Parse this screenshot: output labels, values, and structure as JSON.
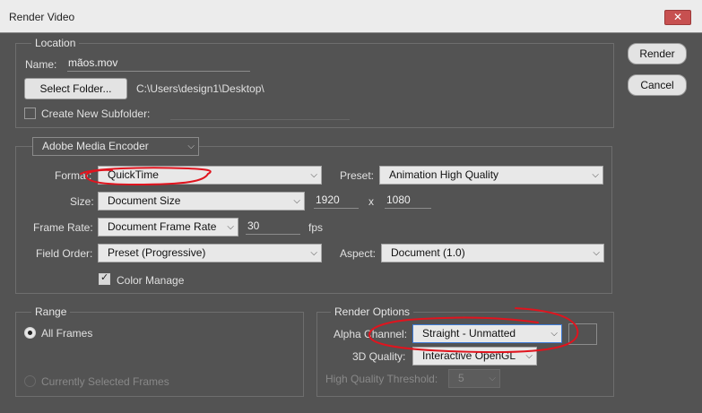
{
  "window": {
    "title": "Render Video",
    "close_glyph": "✕"
  },
  "location": {
    "legend": "Location",
    "name_label": "Name:",
    "name_value": "mãos.mov",
    "select_folder_label": "Select Folder...",
    "folder_path": "C:\\Users\\design1\\Desktop\\",
    "subfolder_label": "Create New Subfolder:",
    "subfolder_checked": false
  },
  "actions": {
    "render_label": "Render",
    "cancel_label": "Cancel"
  },
  "encoder": {
    "selected": "Adobe Media Encoder",
    "format_label": "Format:",
    "format_value": "QuickTime",
    "preset_label": "Preset:",
    "preset_value": "Animation High Quality",
    "size_label": "Size:",
    "size_value": "Document Size",
    "width": "1920",
    "x_sep": "x",
    "height": "1080",
    "frame_rate_label": "Frame Rate:",
    "frame_rate_value": "Document Frame Rate",
    "fps_value": "30",
    "fps_unit": "fps",
    "field_order_label": "Field Order:",
    "field_order_value": "Preset (Progressive)",
    "aspect_label": "Aspect:",
    "aspect_value": "Document (1.0)",
    "color_manage_label": "Color Manage",
    "color_manage_checked": true
  },
  "range": {
    "legend": "Range",
    "all_frames_label": "All Frames",
    "current_frames_label": "Currently Selected Frames"
  },
  "render_options": {
    "legend": "Render Options",
    "alpha_label": "Alpha Channel:",
    "alpha_value": "Straight - Unmatted",
    "quality_label": "3D Quality:",
    "quality_value": "Interactive OpenGL",
    "threshold_label": "High Quality Threshold:",
    "threshold_value": "5"
  },
  "icons": {
    "chevron": "⌵",
    "checkmark": "✓"
  },
  "colors": {
    "annotation": "#e0141e",
    "focus": "#3d7bd8",
    "background": "#535353"
  }
}
